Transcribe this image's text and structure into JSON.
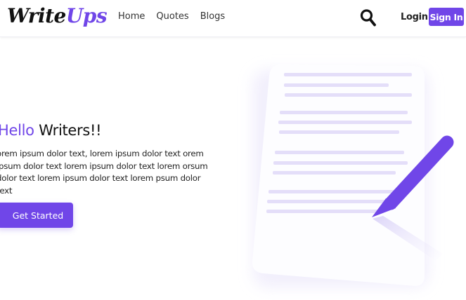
{
  "header": {
    "logo": {
      "part1": "Write",
      "part2": "Ups"
    },
    "nav": [
      {
        "label": "Home"
      },
      {
        "label": "Quotes"
      },
      {
        "label": "Blogs"
      }
    ],
    "search_icon": "search-icon",
    "login_label": "Login",
    "signin_label": "Sign In"
  },
  "hero": {
    "title_accent": "Hello",
    "title_rest": " Writers!!",
    "body": "orem ipsum dolor text, lorem ipsum dolor text orem ipsum dolor text lorem ipsum dolor text lorem orsum dolor text lorem ipsum dolor text lorem psum dolor text",
    "cta_label": "Get Started",
    "illustration_icon": "document-with-pen-icon"
  },
  "colors": {
    "accent": "#7046e8",
    "text": "#111111",
    "line": "#e4def9"
  }
}
